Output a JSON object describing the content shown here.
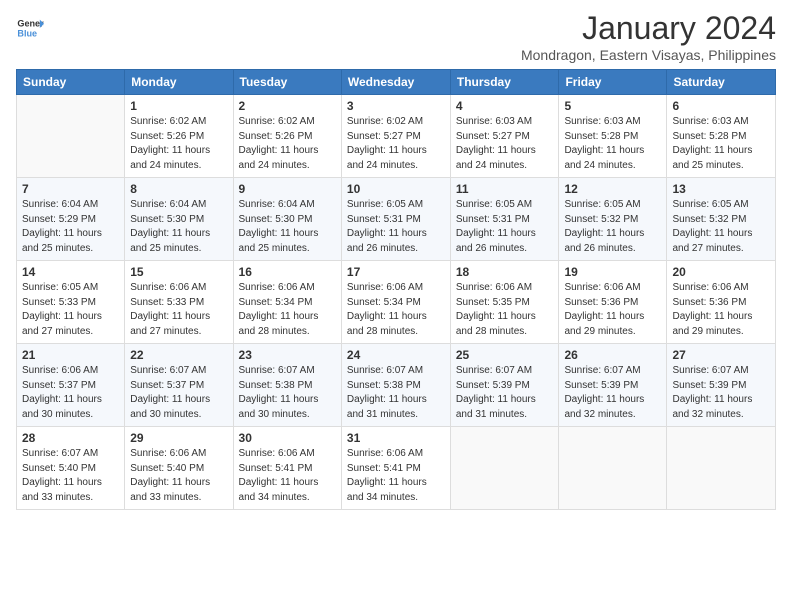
{
  "header": {
    "logo_line1": "General",
    "logo_line2": "Blue",
    "month": "January 2024",
    "location": "Mondragon, Eastern Visayas, Philippines"
  },
  "weekdays": [
    "Sunday",
    "Monday",
    "Tuesday",
    "Wednesday",
    "Thursday",
    "Friday",
    "Saturday"
  ],
  "weeks": [
    [
      {
        "day": "",
        "info": ""
      },
      {
        "day": "1",
        "info": "Sunrise: 6:02 AM\nSunset: 5:26 PM\nDaylight: 11 hours\nand 24 minutes."
      },
      {
        "day": "2",
        "info": "Sunrise: 6:02 AM\nSunset: 5:26 PM\nDaylight: 11 hours\nand 24 minutes."
      },
      {
        "day": "3",
        "info": "Sunrise: 6:02 AM\nSunset: 5:27 PM\nDaylight: 11 hours\nand 24 minutes."
      },
      {
        "day": "4",
        "info": "Sunrise: 6:03 AM\nSunset: 5:27 PM\nDaylight: 11 hours\nand 24 minutes."
      },
      {
        "day": "5",
        "info": "Sunrise: 6:03 AM\nSunset: 5:28 PM\nDaylight: 11 hours\nand 24 minutes."
      },
      {
        "day": "6",
        "info": "Sunrise: 6:03 AM\nSunset: 5:28 PM\nDaylight: 11 hours\nand 25 minutes."
      }
    ],
    [
      {
        "day": "7",
        "info": "Sunrise: 6:04 AM\nSunset: 5:29 PM\nDaylight: 11 hours\nand 25 minutes."
      },
      {
        "day": "8",
        "info": "Sunrise: 6:04 AM\nSunset: 5:30 PM\nDaylight: 11 hours\nand 25 minutes."
      },
      {
        "day": "9",
        "info": "Sunrise: 6:04 AM\nSunset: 5:30 PM\nDaylight: 11 hours\nand 25 minutes."
      },
      {
        "day": "10",
        "info": "Sunrise: 6:05 AM\nSunset: 5:31 PM\nDaylight: 11 hours\nand 26 minutes."
      },
      {
        "day": "11",
        "info": "Sunrise: 6:05 AM\nSunset: 5:31 PM\nDaylight: 11 hours\nand 26 minutes."
      },
      {
        "day": "12",
        "info": "Sunrise: 6:05 AM\nSunset: 5:32 PM\nDaylight: 11 hours\nand 26 minutes."
      },
      {
        "day": "13",
        "info": "Sunrise: 6:05 AM\nSunset: 5:32 PM\nDaylight: 11 hours\nand 27 minutes."
      }
    ],
    [
      {
        "day": "14",
        "info": "Sunrise: 6:05 AM\nSunset: 5:33 PM\nDaylight: 11 hours\nand 27 minutes."
      },
      {
        "day": "15",
        "info": "Sunrise: 6:06 AM\nSunset: 5:33 PM\nDaylight: 11 hours\nand 27 minutes."
      },
      {
        "day": "16",
        "info": "Sunrise: 6:06 AM\nSunset: 5:34 PM\nDaylight: 11 hours\nand 28 minutes."
      },
      {
        "day": "17",
        "info": "Sunrise: 6:06 AM\nSunset: 5:34 PM\nDaylight: 11 hours\nand 28 minutes."
      },
      {
        "day": "18",
        "info": "Sunrise: 6:06 AM\nSunset: 5:35 PM\nDaylight: 11 hours\nand 28 minutes."
      },
      {
        "day": "19",
        "info": "Sunrise: 6:06 AM\nSunset: 5:36 PM\nDaylight: 11 hours\nand 29 minutes."
      },
      {
        "day": "20",
        "info": "Sunrise: 6:06 AM\nSunset: 5:36 PM\nDaylight: 11 hours\nand 29 minutes."
      }
    ],
    [
      {
        "day": "21",
        "info": "Sunrise: 6:06 AM\nSunset: 5:37 PM\nDaylight: 11 hours\nand 30 minutes."
      },
      {
        "day": "22",
        "info": "Sunrise: 6:07 AM\nSunset: 5:37 PM\nDaylight: 11 hours\nand 30 minutes."
      },
      {
        "day": "23",
        "info": "Sunrise: 6:07 AM\nSunset: 5:38 PM\nDaylight: 11 hours\nand 30 minutes."
      },
      {
        "day": "24",
        "info": "Sunrise: 6:07 AM\nSunset: 5:38 PM\nDaylight: 11 hours\nand 31 minutes."
      },
      {
        "day": "25",
        "info": "Sunrise: 6:07 AM\nSunset: 5:39 PM\nDaylight: 11 hours\nand 31 minutes."
      },
      {
        "day": "26",
        "info": "Sunrise: 6:07 AM\nSunset: 5:39 PM\nDaylight: 11 hours\nand 32 minutes."
      },
      {
        "day": "27",
        "info": "Sunrise: 6:07 AM\nSunset: 5:39 PM\nDaylight: 11 hours\nand 32 minutes."
      }
    ],
    [
      {
        "day": "28",
        "info": "Sunrise: 6:07 AM\nSunset: 5:40 PM\nDaylight: 11 hours\nand 33 minutes."
      },
      {
        "day": "29",
        "info": "Sunrise: 6:06 AM\nSunset: 5:40 PM\nDaylight: 11 hours\nand 33 minutes."
      },
      {
        "day": "30",
        "info": "Sunrise: 6:06 AM\nSunset: 5:41 PM\nDaylight: 11 hours\nand 34 minutes."
      },
      {
        "day": "31",
        "info": "Sunrise: 6:06 AM\nSunset: 5:41 PM\nDaylight: 11 hours\nand 34 minutes."
      },
      {
        "day": "",
        "info": ""
      },
      {
        "day": "",
        "info": ""
      },
      {
        "day": "",
        "info": ""
      }
    ]
  ]
}
